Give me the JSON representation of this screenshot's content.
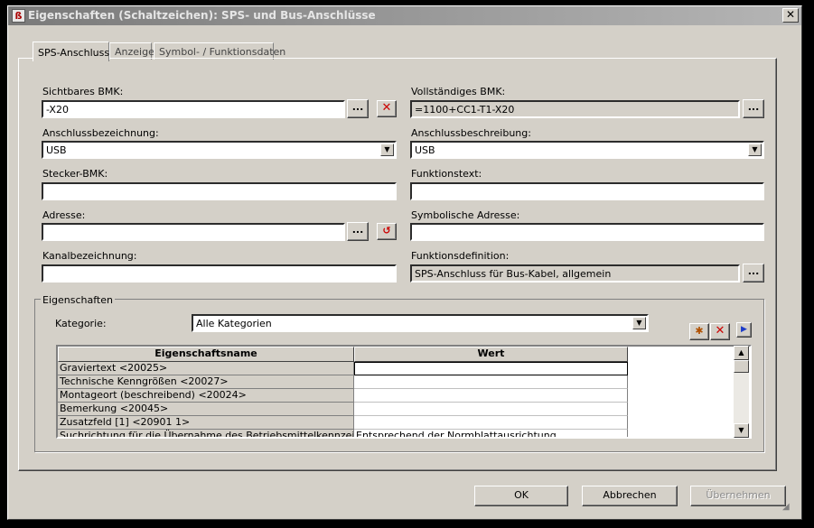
{
  "window": {
    "title": "Eigenschaften (Schaltzeichen): SPS- und Bus-Anschlüsse",
    "close_label": "✕"
  },
  "tabs": [
    {
      "label": "SPS-Anschluss",
      "active": true
    },
    {
      "label": "Anzeige",
      "active": false
    },
    {
      "label": "Symbol- / Funktionsdaten",
      "active": false
    }
  ],
  "fields": {
    "sichtbares_bmk": {
      "label": "Sichtbares BMK:",
      "value": "-X20"
    },
    "vollstaendiges_bmk": {
      "label": "Vollständiges BMK:",
      "value": "=1100+CC1-T1-X20"
    },
    "anschlussbezeichnung": {
      "label": "Anschlussbezeichnung:",
      "value": "USB"
    },
    "anschlussbeschreibung": {
      "label": "Anschlussbeschreibung:",
      "value": "USB"
    },
    "stecker_bmk": {
      "label": "Stecker-BMK:",
      "value": ""
    },
    "funktionstext": {
      "label": "Funktionstext:",
      "value": ""
    },
    "adresse": {
      "label": "Adresse:",
      "value": ""
    },
    "symbolische_adresse": {
      "label": "Symbolische Adresse:",
      "value": ""
    },
    "kanalbezeichnung": {
      "label": "Kanalbezeichnung:",
      "value": ""
    },
    "funktionsdefinition": {
      "label": "Funktionsdefinition:",
      "value": "SPS-Anschluss für Bus-Kabel, allgemein"
    }
  },
  "buttons": {
    "browse": "...",
    "ok": "OK",
    "abbrechen": "Abbrechen",
    "uebernehmen": "Übernehmen"
  },
  "eigenschaften": {
    "legend": "Eigenschaften",
    "kategorie_label": "Kategorie:",
    "kategorie_value": "Alle Kategorien",
    "columns": [
      "Eigenschaftsname",
      "Wert"
    ],
    "rows": [
      {
        "name": "Graviertext <20025>",
        "value": ""
      },
      {
        "name": "Technische Kenngrößen <20027>",
        "value": ""
      },
      {
        "name": "Montageort (beschreibend) <20024>",
        "value": ""
      },
      {
        "name": "Bemerkung <20045>",
        "value": ""
      },
      {
        "name": "Zusatzfeld [1] <20901 1>",
        "value": ""
      },
      {
        "name": "Suchrichtung für die Übernahme des Betriebsmittelkennzeichens",
        "value": "Entsprechend der Normblattausrichtung"
      }
    ]
  },
  "icons": {
    "delete": "delete-x-icon",
    "reset_address": "reset-address-icon",
    "new_property": "new-property-icon",
    "delete_property": "delete-property-icon",
    "expand": "expand-arrow-icon"
  },
  "colors": {
    "dialog_bg": "#d4d0c8",
    "delete_red": "#cc0000"
  }
}
